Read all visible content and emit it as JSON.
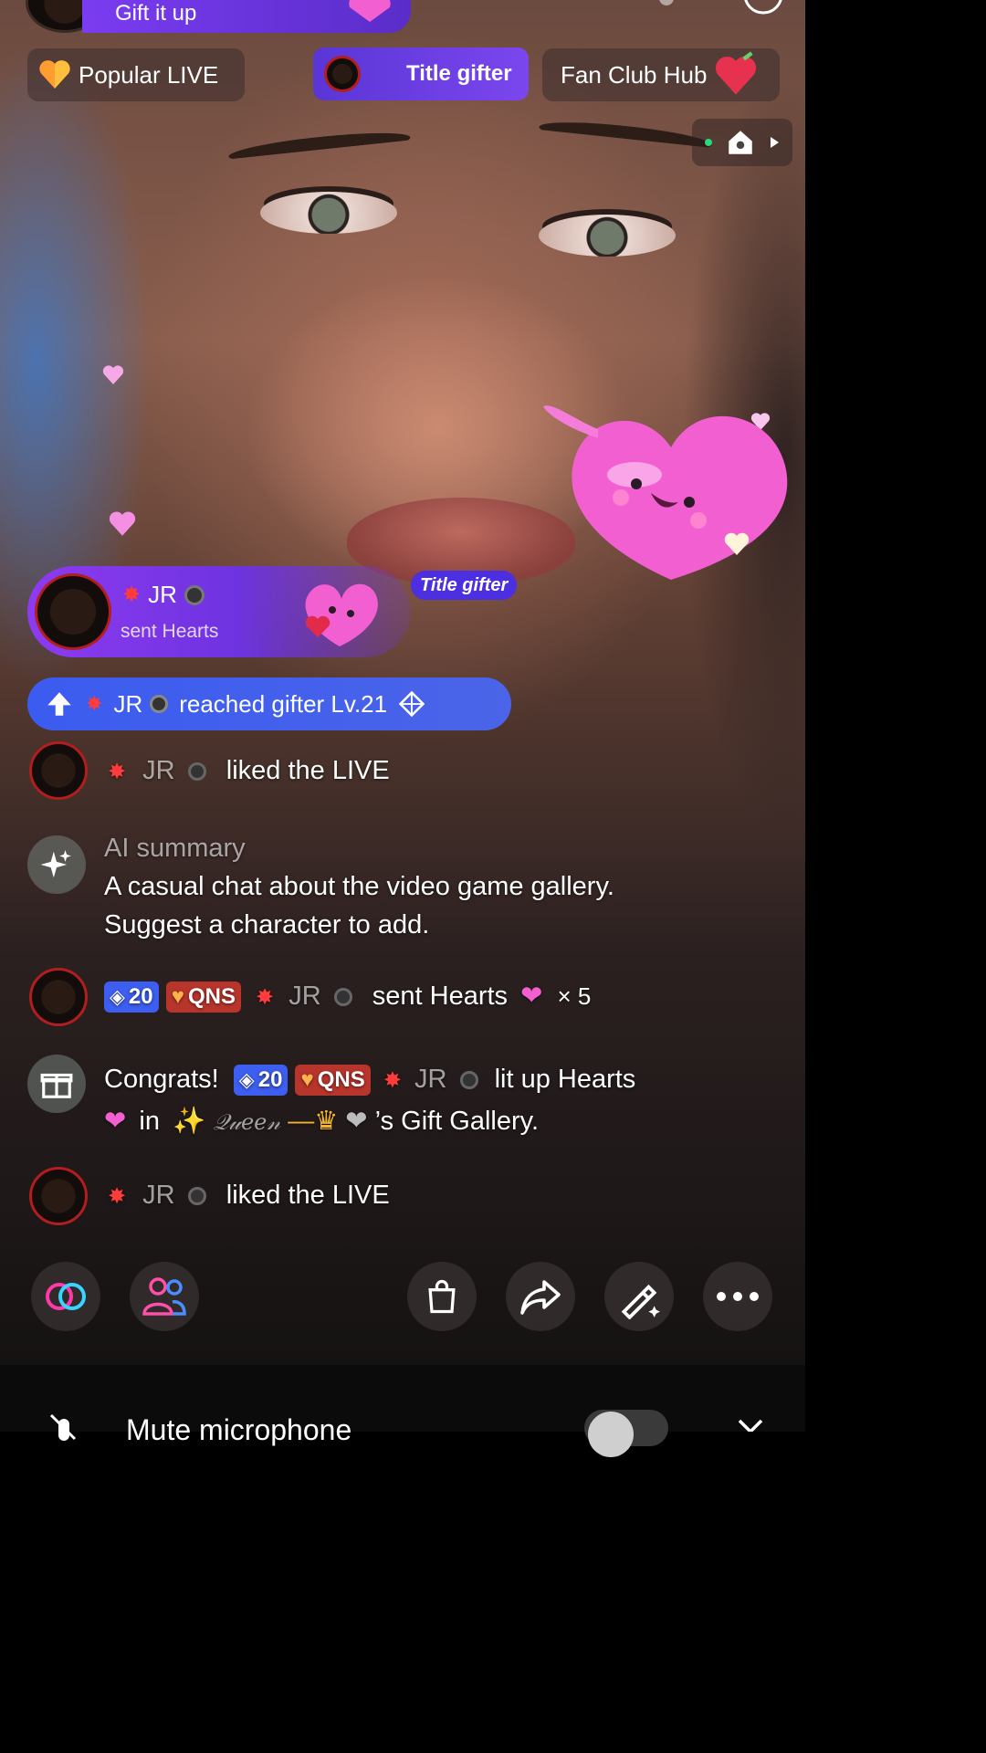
{
  "header": {
    "gift_pill_label": "Gift it up"
  },
  "top_chips": {
    "popular": "Popular LIVE",
    "title_gifter": "Title gifter",
    "fan_club": "Fan Club Hub"
  },
  "gift_banner": {
    "user": "JR",
    "action": "sent Hearts",
    "tag": "Title gifter"
  },
  "level_bar": {
    "user": "JR",
    "text": "reached gifter Lv.21"
  },
  "chat": [
    {
      "user": "JR",
      "text": "liked the LIVE"
    },
    {
      "title": "AI summary",
      "line1": "A casual chat about the video game gallery.",
      "line2": "Suggest a character to add."
    },
    {
      "badge_level": "20",
      "badge_club": "QNS",
      "user": "JR",
      "text": "sent Hearts",
      "multiplier": "× 5"
    },
    {
      "prefix": "Congrats!",
      "badge_level": "20",
      "badge_club": "QNS",
      "user": "JR",
      "text": "lit up Hearts",
      "line2_pre": "in",
      "host": "𝒬𝓊𝑒𝑒𝓃",
      "line2_post": "’s Gift Gallery."
    },
    {
      "user": "JR",
      "text": "liked the LIVE"
    }
  ],
  "bottom": {
    "mute_label": "Mute microphone"
  },
  "colors": {
    "accent_purple": "#7a3cf0",
    "level_blue": "#3d5ef0",
    "club_red": "#b8352c",
    "heart_pink": "#f25fd0"
  }
}
